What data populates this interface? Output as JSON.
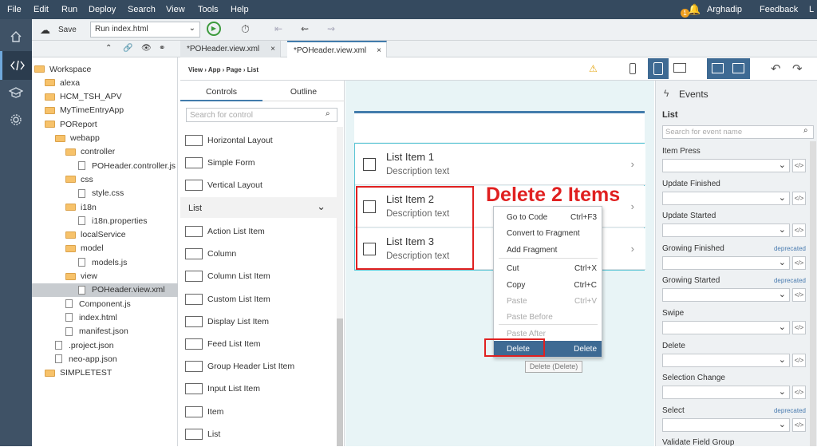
{
  "menu": {
    "items": [
      "File",
      "Edit",
      "Run",
      "Deploy",
      "Search",
      "View",
      "Tools",
      "Help"
    ],
    "user": "Arghadip",
    "feedback": "Feedback",
    "extra": "L",
    "notif_count": "1"
  },
  "toolbar": {
    "save": "Save",
    "run_config": "Run index.html"
  },
  "editor_tabs": [
    "*POHeader.view.xml",
    "*POHeader.view.xml"
  ],
  "workspace": {
    "items": [
      {
        "label": "Workspace",
        "type": "folder"
      },
      {
        "label": "alexa",
        "type": "folder"
      },
      {
        "label": "HCM_TSH_APV",
        "type": "folder"
      },
      {
        "label": "MyTimeEntryApp",
        "type": "folder"
      },
      {
        "label": "POReport",
        "type": "folder"
      },
      {
        "label": "webapp",
        "type": "folder"
      },
      {
        "label": "controller",
        "type": "folder"
      },
      {
        "label": "POHeader.controller.js",
        "type": "file"
      },
      {
        "label": "css",
        "type": "folder"
      },
      {
        "label": "style.css",
        "type": "file"
      },
      {
        "label": "i18n",
        "type": "folder"
      },
      {
        "label": "i18n.properties",
        "type": "file"
      },
      {
        "label": "localService",
        "type": "folder"
      },
      {
        "label": "model",
        "type": "folder"
      },
      {
        "label": "models.js",
        "type": "file"
      },
      {
        "label": "view",
        "type": "folder"
      },
      {
        "label": "POHeader.view.xml",
        "type": "file"
      },
      {
        "label": "Component.js",
        "type": "file"
      },
      {
        "label": "index.html",
        "type": "file"
      },
      {
        "label": "manifest.json",
        "type": "file"
      },
      {
        "label": ".project.json",
        "type": "file"
      },
      {
        "label": "neo-app.json",
        "type": "file"
      },
      {
        "label": "SIMPLETEST",
        "type": "folder"
      }
    ]
  },
  "breadcrumb": "View › App › Page › List",
  "controls": {
    "tab_controls": "Controls",
    "tab_outline": "Outline",
    "search_placeholder": "Search for control",
    "layout_items": [
      "Horizontal Layout",
      "Simple Form",
      "Vertical Layout"
    ],
    "section": "List",
    "list_items": [
      "Action List Item",
      "Column",
      "Column List Item",
      "Custom List Item",
      "Display List Item",
      "Feed List Item",
      "Group Header List Item",
      "Input List Item",
      "Item",
      "List"
    ]
  },
  "canvas": {
    "items": [
      {
        "title": "List Item 1",
        "desc": "Description text"
      },
      {
        "title": "List Item 2",
        "desc": "Description text"
      },
      {
        "title": "List Item 3",
        "desc": "Description text"
      }
    ],
    "annotation": "Delete 2 Items"
  },
  "context_menu": {
    "items": [
      {
        "label": "Go to Code",
        "shortcut": "Ctrl+F3"
      },
      {
        "label": "Convert to Fragment",
        "shortcut": ""
      },
      {
        "label": "Add Fragment",
        "shortcut": ""
      },
      {
        "label": "Cut",
        "shortcut": "Ctrl+X"
      },
      {
        "label": "Copy",
        "shortcut": "Ctrl+C"
      },
      {
        "label": "Paste",
        "shortcut": "Ctrl+V"
      },
      {
        "label": "Paste Before",
        "shortcut": ""
      },
      {
        "label": "Paste After",
        "shortcut": ""
      },
      {
        "label": "Delete",
        "shortcut": "Delete"
      }
    ],
    "tooltip": "Delete (Delete)"
  },
  "events": {
    "header": "Events",
    "control": "List",
    "search_placeholder": "Search for event name",
    "deprecated": "deprecated",
    "items": [
      "Item Press",
      "Update Finished",
      "Update Started",
      "Growing Finished",
      "Growing Started",
      "Swipe",
      "Delete",
      "Selection Change",
      "Select",
      "Validate Field Group"
    ]
  }
}
